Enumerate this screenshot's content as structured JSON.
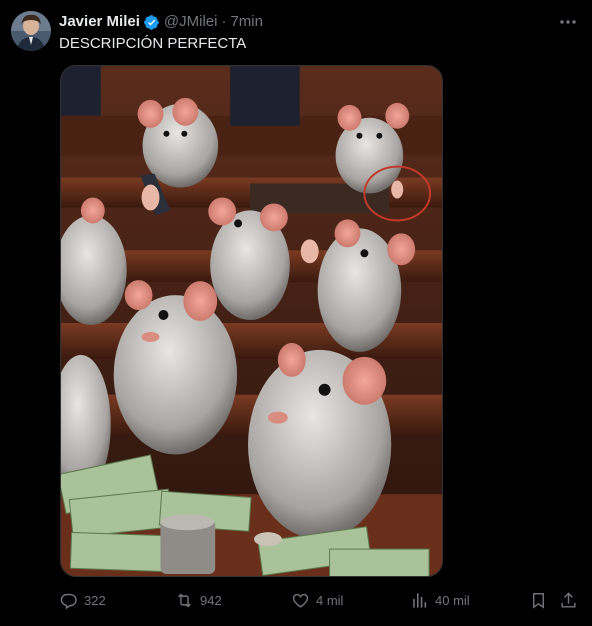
{
  "author": {
    "name": "Javier Milei",
    "handle": "@JMilei",
    "separator": "·",
    "time": "7min",
    "verified": true
  },
  "tweet": {
    "text": "DESCRIPCIÓN PERFECTA",
    "media_icon": "ai-generated-image-rats-in-congress"
  },
  "actions": {
    "replies": "322",
    "reposts": "942",
    "likes": "4 mil",
    "views": "40 mil"
  },
  "colors": {
    "background": "#000000",
    "text_primary": "#e7e9ea",
    "text_secondary": "#71767b",
    "verified_blue": "#1d9bf0",
    "border": "#2f3336"
  }
}
